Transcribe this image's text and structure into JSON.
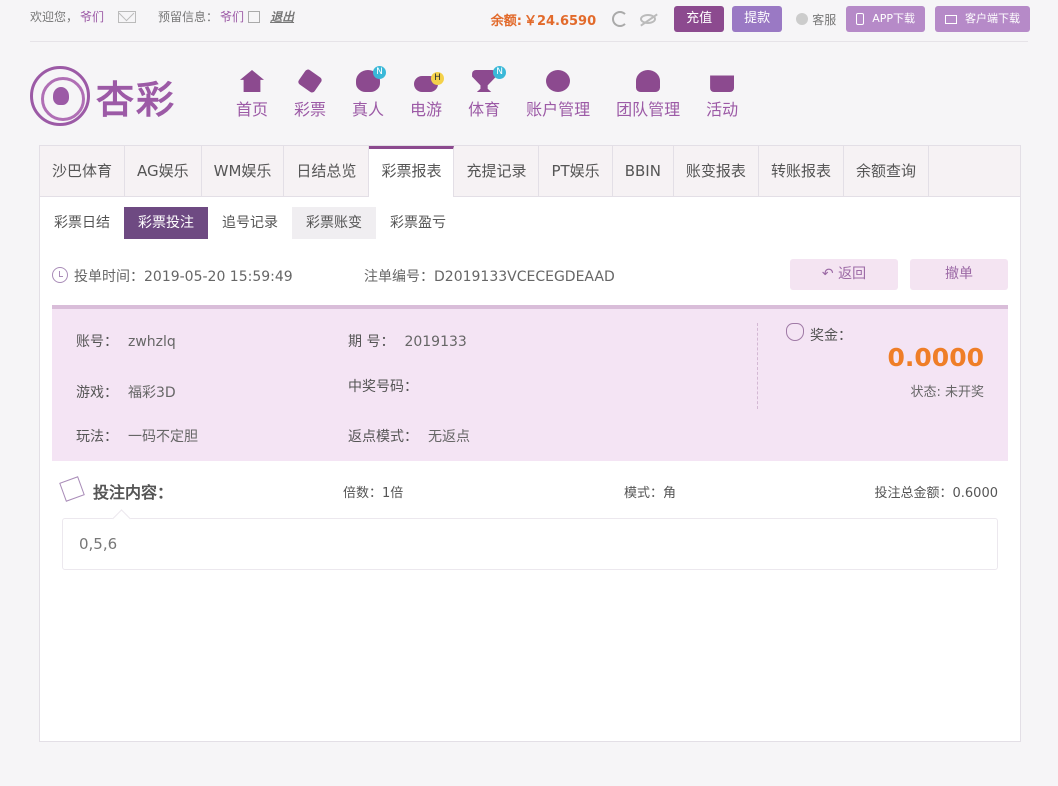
{
  "topbar": {
    "welcome": "欢迎您，",
    "username": "爷们",
    "reserve_label": "预留信息：",
    "reserve_value": "爷们",
    "logout": "退出",
    "balance_label": "余额:",
    "balance_value": "￥24.6590",
    "recharge": "充值",
    "withdraw": "提款",
    "customer_service": "客服",
    "app_download": "APP下载",
    "client_download": "客户端下载"
  },
  "logo": {
    "brand": "杏彩"
  },
  "nav": [
    {
      "label": "首页",
      "icon": "home-icon"
    },
    {
      "label": "彩票",
      "icon": "ticket-icon"
    },
    {
      "label": "真人",
      "icon": "dealer-icon",
      "badge": "N"
    },
    {
      "label": "电游",
      "icon": "gamepad-icon",
      "badge": "H"
    },
    {
      "label": "体育",
      "icon": "trophy-icon",
      "badge": "N"
    },
    {
      "label": "账户管理",
      "icon": "coin-icon"
    },
    {
      "label": "团队管理",
      "icon": "team-icon"
    },
    {
      "label": "活动",
      "icon": "gift-icon"
    }
  ],
  "tabs": [
    "沙巴体育",
    "AG娱乐",
    "WM娱乐",
    "日结总览",
    "彩票报表",
    "充提记录",
    "PT娱乐",
    "BBIN",
    "账变报表",
    "转账报表",
    "余额查询"
  ],
  "active_tab": "彩票报表",
  "subtabs": [
    "彩票日结",
    "彩票投注",
    "追号记录",
    "彩票账变",
    "彩票盈亏"
  ],
  "active_subtab": "彩票投注",
  "detail": {
    "bet_time_label": "投单时间：",
    "bet_time": "2019-05-20 15:59:49",
    "bet_no_label": "注单编号：",
    "bet_no": "D2019133VCECEGDEAAD",
    "back": "返回",
    "cancel": "撤单"
  },
  "card": {
    "account_label": "账号：",
    "account": "zwhzlq",
    "period_label": "期 号：",
    "period": "2019133",
    "game_label": "游戏：",
    "game": "福彩3D",
    "win_no_label": "中奖号码：",
    "win_no": "",
    "play_label": "玩法：",
    "play": "一码不定胆",
    "rebate_label": "返点模式：",
    "rebate": "无返点",
    "prize_label": "奖金：",
    "prize": "0.0000",
    "status_label": "状态: ",
    "status": "未开奖"
  },
  "content": {
    "title": "投注内容：",
    "multiple": "倍数：1倍",
    "mode": "模式：角",
    "total": "投注总金额：0.6000",
    "numbers": "0,5,6"
  },
  "colors": {
    "accent": "#8c4a8f",
    "orange": "#ef7e27",
    "card_bg": "#f4e4f4"
  }
}
